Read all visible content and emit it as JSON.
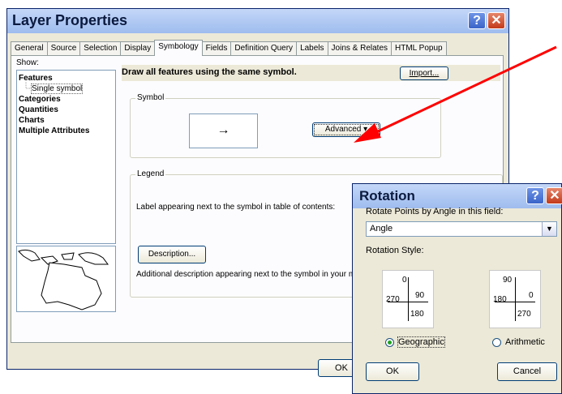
{
  "main": {
    "title": "Layer Properties",
    "tabs": [
      "General",
      "Source",
      "Selection",
      "Display",
      "Symbology",
      "Fields",
      "Definition Query",
      "Labels",
      "Joins & Relates",
      "HTML Popup"
    ],
    "active_tab": "Symbology",
    "show_label": "Show:",
    "show_items": [
      {
        "label": "Features",
        "level": 0
      },
      {
        "label": "Single symbol",
        "level": 1
      },
      {
        "label": "Categories",
        "level": 0
      },
      {
        "label": "Quantities",
        "level": 0
      },
      {
        "label": "Charts",
        "level": 0
      },
      {
        "label": "Multiple Attributes",
        "level": 0
      }
    ],
    "description_heading": "Draw all features using the same symbol.",
    "import_button": "Import...",
    "symbol_group": "Symbol",
    "symbol_preview": "→",
    "advanced_button": "Advanced",
    "legend_group": "Legend",
    "legend_label_text": "Label appearing next to the symbol in table of contents:",
    "description_button": "Description...",
    "description_text": "Additional description appearing next to the symbol in your ma",
    "ok_button": "OK"
  },
  "rotation": {
    "title": "Rotation",
    "field_label": "Rotate Points by Angle in this field:",
    "field_value": "Angle",
    "style_label": "Rotation Style:",
    "geographic": {
      "top": "0",
      "right": "90",
      "bottom": "180",
      "left": "270"
    },
    "arithmetic": {
      "top": "90",
      "right": "0",
      "bottom": "270",
      "left": "180"
    },
    "options": [
      {
        "label": "Geographic",
        "selected": true
      },
      {
        "label": "Arithmetic",
        "selected": false
      }
    ],
    "ok_button": "OK",
    "cancel_button": "Cancel"
  },
  "colors": {
    "arrow": "#ff0000",
    "title_text": "#0b1a3e",
    "close_button": "#c33a1a"
  }
}
